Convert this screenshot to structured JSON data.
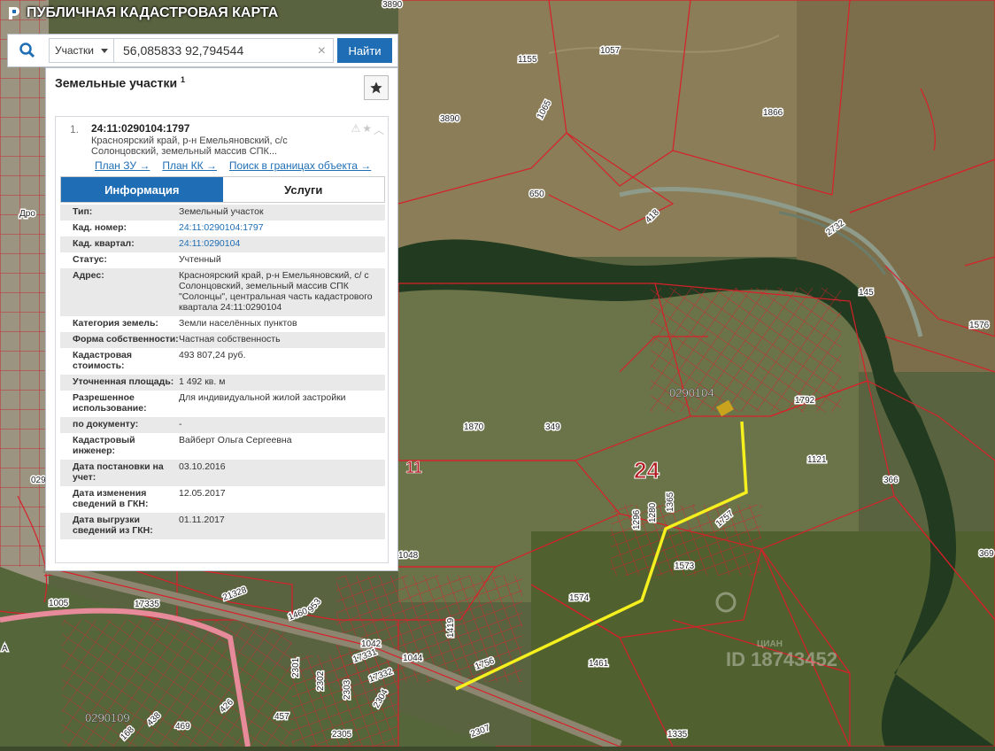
{
  "app": {
    "title": "ПУБЛИЧНАЯ КАДАСТРОВАЯ КАРТА"
  },
  "search": {
    "type_label": "Участки",
    "query": "56,085833 92,794544",
    "find_label": "Найти",
    "clear_symbol": "×"
  },
  "panel": {
    "heading": "Земельные участки",
    "heading_count": "1"
  },
  "card": {
    "number": "1.",
    "cad_id": "24:11:0290104:1797",
    "address_short": "Красноярский край, р-н Емельяновский, с/с Солонцовский, земельный массив СПК...",
    "links": [
      "План ЗУ →",
      "План КК →",
      "Поиск в границах объекта →"
    ],
    "tabs": [
      "Информация",
      "Услуги"
    ],
    "rows": [
      {
        "key": "Тип:",
        "value": "Земельный участок",
        "link": false
      },
      {
        "key": "Кад. номер:",
        "value": "24:11:0290104:1797",
        "link": true
      },
      {
        "key": "Кад. квартал:",
        "value": "24:11:0290104",
        "link": true
      },
      {
        "key": "Статус:",
        "value": "Учтенный",
        "link": false
      },
      {
        "key": "Адрес:",
        "value": "Красноярский край, р-н Емельяновский, с/ с Солонцовский, земельный массив СПК \"Солонцы\", центральная часть кадастрового квартала 24:11:0290104",
        "link": false
      },
      {
        "key": "Категория земель:",
        "value": "Земли населённых пунктов",
        "link": false
      },
      {
        "key": "Форма собственности:",
        "value": "Частная собственность",
        "link": false
      },
      {
        "key": "Кадастровая стоимость:",
        "value": "493 807,24 руб.",
        "link": false
      },
      {
        "key": "Уточненная площадь:",
        "value": "1 492 кв. м",
        "link": false
      },
      {
        "key": "Разрешенное использование:",
        "value": "Для индивидуальной жилой застройки",
        "link": false
      },
      {
        "key": "по документу:",
        "value": "-",
        "link": false
      },
      {
        "key": "Кадастровый инженер:",
        "value": "Вайберт Ольга Сергеевна",
        "link": false
      },
      {
        "key": "Дата постановки на учет:",
        "value": "03.10.2016",
        "link": false
      },
      {
        "key": "Дата изменения сведений в ГКН:",
        "value": "12.05.2017",
        "link": false
      },
      {
        "key": "Дата выгрузки сведений из ГКН:",
        "value": "01.11.2017",
        "link": false
      }
    ]
  },
  "map": {
    "labels": [
      "3890",
      "1155",
      "1057",
      "1866",
      "1065",
      "3890",
      "650",
      "418",
      "2732",
      "145",
      "1576",
      "0290104",
      "1792",
      "1870",
      "349",
      "11",
      "24",
      "1121",
      "366",
      "1757",
      "1573",
      "369",
      "1048",
      "1574",
      "1005",
      "17335",
      "21328",
      "1460",
      "953",
      "1042",
      "1044",
      "1419",
      "1756",
      "1461",
      "17331",
      "17332",
      "2301",
      "2302",
      "2303",
      "2304",
      "2305",
      "2307",
      "1335",
      "0290109",
      "426",
      "469",
      "438",
      "168",
      "457",
      "1296",
      "1280",
      "1365",
      "0290",
      "Дро",
      "А",
      "ID 18743452"
    ],
    "watermark": "ЦИАН"
  },
  "colors": {
    "accent": "#1f6eb5",
    "parcel_line": "#d8202a",
    "route": "#f5f01e"
  }
}
